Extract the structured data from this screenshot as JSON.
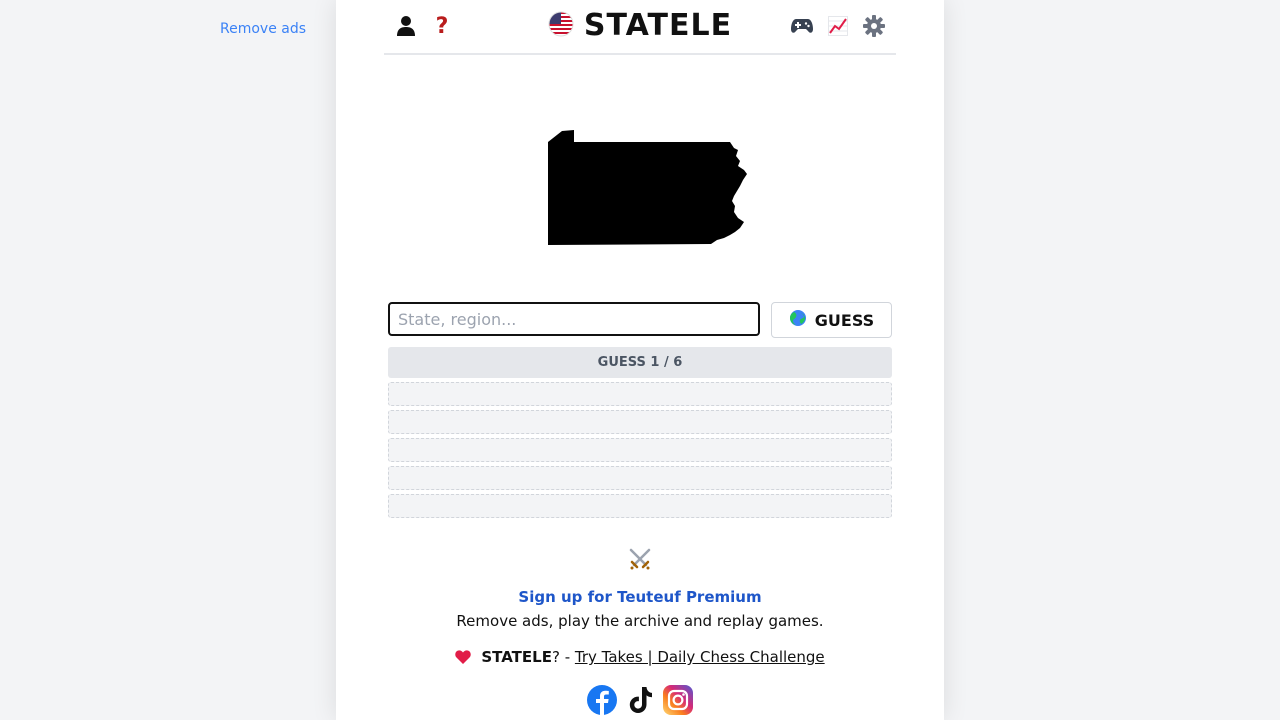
{
  "sidebar": {
    "remove_ads_label": "Remove ads"
  },
  "header": {
    "title": "STATELE",
    "help_label": "?",
    "left_icons": [
      "user-icon",
      "help-icon"
    ],
    "right_icons": [
      "gamepad-icon",
      "stats-chart-icon",
      "gear-icon"
    ],
    "flag_icon": "us-flag-icon"
  },
  "game": {
    "shape_icon": "pennsylvania-silhouette",
    "input_placeholder": "State, region...",
    "input_value": "",
    "guess_button_label": "GUESS",
    "guess_button_icon": "globe-icon",
    "guess_counter": "GUESS 1 / 6",
    "empty_slots": 5
  },
  "promo": {
    "icon": "crossed-swords-icon",
    "signup_label": "Sign up for Teuteuf Premium",
    "signup_sub": "Remove ads, play the archive and replay games.",
    "brand": "STATELE",
    "question_suffix": "? - ",
    "link_label": "Try Takes | Daily Chess Challenge"
  },
  "socials": [
    "facebook-icon",
    "tiktok-icon",
    "instagram-icon"
  ],
  "colors": {
    "background": "#f3f4f6",
    "accent_link": "#1e56c9",
    "help_red": "#b91c1c",
    "heart_red": "#e11d48"
  }
}
